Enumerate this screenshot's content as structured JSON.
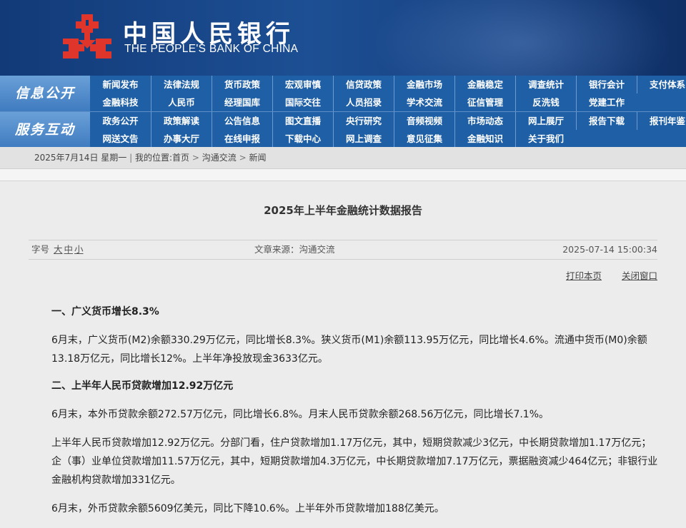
{
  "header": {
    "brand_cn": "中国人民银行",
    "brand_en": "THE PEOPLE'S BANK OF CHINA",
    "logo_icon": "pboc-logo-icon",
    "logo_color": "#e0352b"
  },
  "nav": {
    "group1_label": "信息公开",
    "group2_label": "服务互动",
    "row1": [
      "新闻发布",
      "法律法规",
      "货币政策",
      "宏观审慎",
      "信贷政策",
      "金融市场",
      "金融稳定",
      "调查统计",
      "银行会计",
      "支付体系"
    ],
    "row2": [
      "金融科技",
      "人民币",
      "经理国库",
      "国际交往",
      "人员招录",
      "学术交流",
      "征信管理",
      "反洗钱",
      "党建工作"
    ],
    "row3": [
      "政务公开",
      "政策解读",
      "公告信息",
      "图文直播",
      "央行研究",
      "音频视频",
      "市场动态",
      "网上展厅",
      "报告下载",
      "报刊年鉴"
    ],
    "row4": [
      "网送文告",
      "办事大厅",
      "在线申报",
      "下载中心",
      "网上调查",
      "意见征集",
      "金融知识",
      "关于我们"
    ]
  },
  "breadcrumb": {
    "date": "2025年7月14日 星期一",
    "prefix": "我的位置:",
    "home": "首页",
    "section": "沟通交流",
    "current": "新闻"
  },
  "article": {
    "title": "2025年上半年金融统计数据报告",
    "font_size_label": "字号",
    "font_large": "大",
    "font_medium": "中",
    "font_small": "小",
    "source": "文章来源：沟通交流",
    "time": "2025-07-14 15:00:34",
    "print": "打印本页",
    "close": "关闭窗口",
    "h1": "一、广义货币增长8.3%",
    "p1": "6月末，广义货币(M2)余额330.29万亿元，同比增长8.3%。狭义货币(M1)余额113.95万亿元，同比增长4.6%。流通中货币(M0)余额13.18万亿元，同比增长12%。上半年净投放现金3633亿元。",
    "h2": "二、上半年人民币贷款增加12.92万亿元",
    "p2": "6月末，本外币贷款余额272.57万亿元，同比增长6.8%。月末人民币贷款余额268.56万亿元，同比增长7.1%。",
    "p3": "上半年人民币贷款增加12.92万亿元。分部门看，住户贷款增加1.17万亿元，其中，短期贷款减少3亿元，中长期贷款增加1.17万亿元；企（事）业单位贷款增加11.57万亿元，其中，短期贷款增加4.3万亿元，中长期贷款增加7.17万亿元，票据融资减少464亿元；非银行业金融机构贷款增加331亿元。",
    "p4": "6月末，外币贷款余额5609亿美元，同比下降10.6%。上半年外币贷款增加188亿美元。"
  }
}
